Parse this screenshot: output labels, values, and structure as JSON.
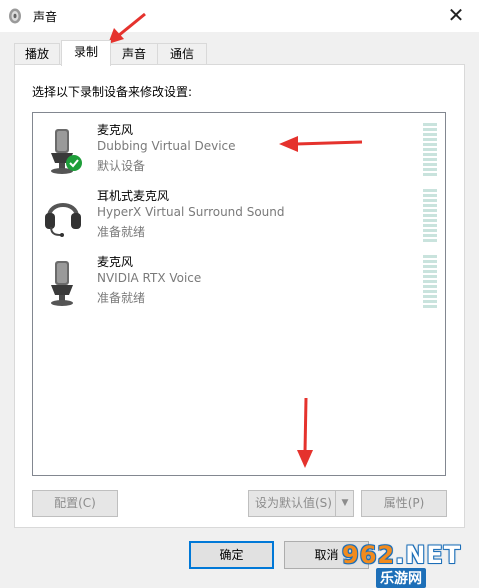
{
  "window": {
    "title": "声音",
    "close_glyph": "✕",
    "icon": "speaker-icon"
  },
  "tabs": [
    {
      "label": "播放",
      "active": false
    },
    {
      "label": "录制",
      "active": true
    },
    {
      "label": "声音",
      "active": false
    },
    {
      "label": "通信",
      "active": false
    }
  ],
  "panel": {
    "prompt": "选择以下录制设备来修改设置:",
    "devices": [
      {
        "name": "麦克风",
        "description": "Dubbing Virtual Device",
        "status": "默认设备",
        "icon": "microphone-icon",
        "default": true
      },
      {
        "name": "耳机式麦克风",
        "description": "HyperX Virtual Surround Sound",
        "status": "准备就绪",
        "icon": "headset-icon",
        "default": false
      },
      {
        "name": "麦克风",
        "description": "NVIDIA RTX Voice",
        "status": "准备就绪",
        "icon": "microphone-icon",
        "default": false
      }
    ],
    "buttons": {
      "configure": "配置(C)",
      "set_default": "设为默认值(S)",
      "set_default_arrow": "▼",
      "properties": "属性(P)"
    }
  },
  "footer": {
    "ok": "确定",
    "cancel": "取消"
  },
  "watermark": {
    "brand": "962.NET",
    "sub": "乐游网"
  },
  "colors": {
    "accent": "#0078d7",
    "annotation_arrow": "#e5322d",
    "level_meter": "#c9e3dd",
    "default_check": "#1e9e3a"
  }
}
